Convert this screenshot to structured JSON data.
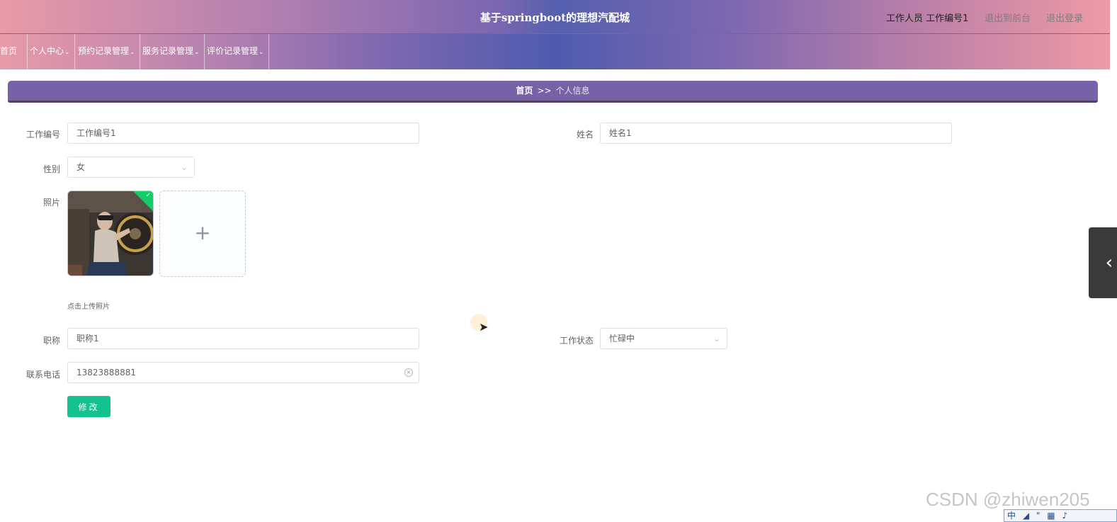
{
  "header": {
    "title": "基于springboot的理想汽配城",
    "user_role": "工作人员",
    "user_name": "工作编号1",
    "back_to_front": "退出到前台",
    "logout": "退出登录"
  },
  "nav": {
    "items": [
      {
        "label": "首页",
        "has_dropdown": false
      },
      {
        "label": "个人中心",
        "has_dropdown": true
      },
      {
        "label": "预约记录管理",
        "has_dropdown": true
      },
      {
        "label": "服务记录管理",
        "has_dropdown": true
      },
      {
        "label": "评价记录管理",
        "has_dropdown": true
      }
    ]
  },
  "breadcrumb": {
    "home": "首页",
    "separator": ">>",
    "current": "个人信息"
  },
  "form": {
    "work_id": {
      "label": "工作编号",
      "value": "工作编号1"
    },
    "name": {
      "label": "姓名",
      "value": "姓名1"
    },
    "gender": {
      "label": "性别",
      "value": "女"
    },
    "photo": {
      "label": "照片",
      "upload_tip": "点击上传照片",
      "upload_icon": "+"
    },
    "title": {
      "label": "职称",
      "value": "职称1"
    },
    "work_status": {
      "label": "工作状态",
      "value": "忙碌中"
    },
    "phone": {
      "label": "联系电话",
      "value": "13823888881"
    },
    "submit_label": "修改"
  },
  "watermark": "CSDN @zhiwen205",
  "ime": [
    "中",
    "◢",
    "\"",
    "▦",
    "♪"
  ],
  "colors": {
    "accent_green": "#13c28f",
    "breadcrumb_bg": "#7762a8",
    "header_gradient_center": "#5560ae",
    "header_gradient_edge": "#e89aa8"
  }
}
